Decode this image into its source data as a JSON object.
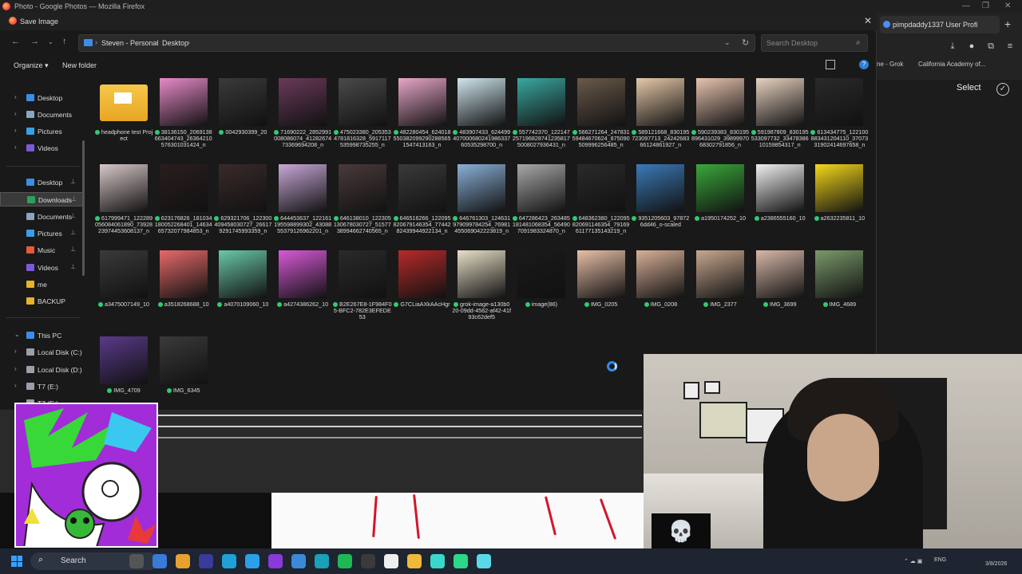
{
  "window": {
    "title": "Photo - Google Photos — Mozilla Firefox"
  },
  "browser": {
    "tab_label": "pimpdaddy1337 User Profi",
    "bookmarks": [
      "ne - Grok",
      "California Academy of..."
    ],
    "select_label": "Select"
  },
  "dialog": {
    "title": "Save Image",
    "breadcrumb": [
      "Steven - Personal",
      "Desktop"
    ],
    "search_placeholder": "Search Desktop",
    "organize_label": "Organize",
    "new_folder_label": "New folder"
  },
  "nav": {
    "items": [
      {
        "label": "Desktop",
        "icon": "desktop-icon",
        "color": "#3a8ee6",
        "chev": "›",
        "pin": ""
      },
      {
        "label": "Documents",
        "icon": "documents-icon",
        "color": "#8aa4c4",
        "chev": "›",
        "pin": ""
      },
      {
        "label": "Pictures",
        "icon": "pictures-icon",
        "color": "#3aa0e6",
        "chev": "›",
        "pin": ""
      },
      {
        "label": "Videos",
        "icon": "videos-icon",
        "color": "#7a5ad8",
        "chev": "›",
        "pin": ""
      },
      {
        "label": "Desktop",
        "icon": "desktop-icon",
        "color": "#3a8ee6",
        "chev": "",
        "pin": "📌"
      },
      {
        "label": "Downloads",
        "icon": "downloads-icon",
        "color": "#2ea05a",
        "chev": "",
        "pin": "📌"
      },
      {
        "label": "Documents",
        "icon": "documents-icon",
        "color": "#8aa4c4",
        "chev": "",
        "pin": "📌"
      },
      {
        "label": "Pictures",
        "icon": "pictures-icon",
        "color": "#3aa0e6",
        "chev": "",
        "pin": "📌"
      },
      {
        "label": "Music",
        "icon": "music-icon",
        "color": "#e65a3a",
        "chev": "",
        "pin": "📌"
      },
      {
        "label": "Videos",
        "icon": "videos-icon",
        "color": "#7a5ad8",
        "chev": "",
        "pin": "📌"
      },
      {
        "label": "me",
        "icon": "folder-icon",
        "color": "#e8b22a",
        "chev": "",
        "pin": ""
      },
      {
        "label": "BACKUP",
        "icon": "folder-icon",
        "color": "#e8b22a",
        "chev": "",
        "pin": ""
      },
      {
        "label": "This PC",
        "icon": "pc-icon",
        "color": "#3a8ee6",
        "chev": "⌄",
        "pin": ""
      },
      {
        "label": "Local Disk (C:)",
        "icon": "disk-icon",
        "color": "#9aa0a8",
        "chev": "›",
        "pin": ""
      },
      {
        "label": "Local Disk (D:)",
        "icon": "disk-icon",
        "color": "#9aa0a8",
        "chev": "›",
        "pin": ""
      },
      {
        "label": "T7 (E:)",
        "icon": "disk-icon",
        "color": "#9aa0a8",
        "chev": "›",
        "pin": ""
      },
      {
        "label": "T7 (E:)",
        "icon": "disk-icon",
        "color": "#9aa0a8",
        "chev": "⌄",
        "pin": ""
      }
    ]
  },
  "files": [
    {
      "name": "headphone test Project",
      "thumb": "folder"
    },
    {
      "name": "38136150_206913866340474​3_2636421057630​1031424_n",
      "thumb": "#e88ac8"
    },
    {
      "name": "0042930399_20",
      "thumb": "#3a3a3a"
    },
    {
      "name": "71690222_2852991008086074_4128267473369694208_n",
      "thumb": "#6a3a5a"
    },
    {
      "name": "475023380_2053534781816328_5917117535998735255_n",
      "thumb": "#4a4a4a"
    },
    {
      "name": "482280454_6240185503820992902885651547413163_n",
      "thumb": "#e8a6c8"
    },
    {
      "name": "483907433_6244994070006802419863376053​5298700_n",
      "thumb": "#cfe6ee"
    },
    {
      "name": "557742370_1221472571968287412358175008027936431_n",
      "thumb": "#3aa8a0"
    },
    {
      "name": "566271264_2478315948467062​4_875090509996256485_n",
      "thumb": "#6a5a4a"
    },
    {
      "name": "589121668_83019572309771​3_242426836612486192​7_n",
      "thumb": "#e6c8a8"
    },
    {
      "name": "590239383_830195896431029_398999706830​2791856_n",
      "thumb": "#e8c4b0"
    },
    {
      "name": "591987809_830195533097732_334783861015​9854317_n",
      "thumb": "#e8d2c0"
    },
    {
      "name": "613434775_1221008834312041​10_370733190​2414697658_n",
      "thumb": "#2a2a2a"
    },
    {
      "name": "617999471_1222890560840618​90_739282397445360813​7_n",
      "thumb": "#d8c8c8"
    },
    {
      "name": "623176826_181034180052268401_14634657320​77984853_n",
      "thumb": "#2a1e1e"
    },
    {
      "name": "629321706_12230040945803072​7_266179291745993359_n",
      "thumb": "#3a2a2a"
    },
    {
      "name": "644453637_1221611955988993​02_4308855379​1269622​01_n",
      "thumb": "#c8a8d8"
    },
    {
      "name": "646138010_1223051306780307​27_515773899466​2740565_n",
      "thumb": "#4a3a3a"
    },
    {
      "name": "646516266_1220958206791463​54_7744282439​944922134_n",
      "thumb": "#3a3a3a"
    },
    {
      "name": "646761303_12463197909978425​4_769814550690​42223819_n",
      "thumb": "#8ab0d8"
    },
    {
      "name": "647286423_26348518148106835​4_564907091983324870_n",
      "thumb": "#a8a8a8"
    },
    {
      "name": "648362380_1220958206911463​54_7916961177135143219_n",
      "thumb": "#2a2a2a"
    },
    {
      "name": "9351205603_978726dd46_o-scaled",
      "thumb": "#3a7ab8"
    },
    {
      "name": "a1950174252_10",
      "thumb": "#3aa83a"
    },
    {
      "name": "a2386555160_10",
      "thumb": "#f0f0f0"
    },
    {
      "name": "a2632235811_10",
      "thumb": "#f4d81a"
    },
    {
      "name": "a3475007149_10",
      "thumb": "#3a3a3a"
    },
    {
      "name": "a3518268688_10",
      "thumb": "#e86a6a"
    },
    {
      "name": "a4070109060_10",
      "thumb": "#6ac8a8"
    },
    {
      "name": "a4274386262_10",
      "thumb": "#d85ad8"
    },
    {
      "name": "B2E267E8-1F984F05-BFC2-782E3EFEDE53",
      "thumb": "#2a2a2a"
    },
    {
      "name": "G7CLiaAXkAAcHgr",
      "thumb": "#b82a2a"
    },
    {
      "name": "grok-image-a130b020-09dd-4562-af42-41f93c62def5",
      "thumb": "#e8e0c8"
    },
    {
      "name": "image(86)",
      "thumb": "#1a1a1a"
    },
    {
      "name": "IMG_0205",
      "thumb": "#e8c0a8"
    },
    {
      "name": "IMG_0208",
      "thumb": "#d8b098"
    },
    {
      "name": "IMG_2377",
      "thumb": "#c8a890"
    },
    {
      "name": "IMG_3699",
      "thumb": "#d8b8a8"
    },
    {
      "name": "IMG_4689",
      "thumb": "#7a9a6a"
    },
    {
      "name": "IMG_4709",
      "thumb": "#5a3a8a"
    },
    {
      "name": "IMG_6345",
      "thumb": "#3a3a3a"
    }
  ],
  "taskbar": {
    "search_label": "Search",
    "tray_lang": "ENG",
    "tray_date": "3/8/2026"
  },
  "overlay": {
    "skull_glyph": "💀"
  },
  "colors": {
    "accent": "#2d8cf0",
    "sync_badge": "#2ecc71",
    "folder": "#f0b93a"
  }
}
